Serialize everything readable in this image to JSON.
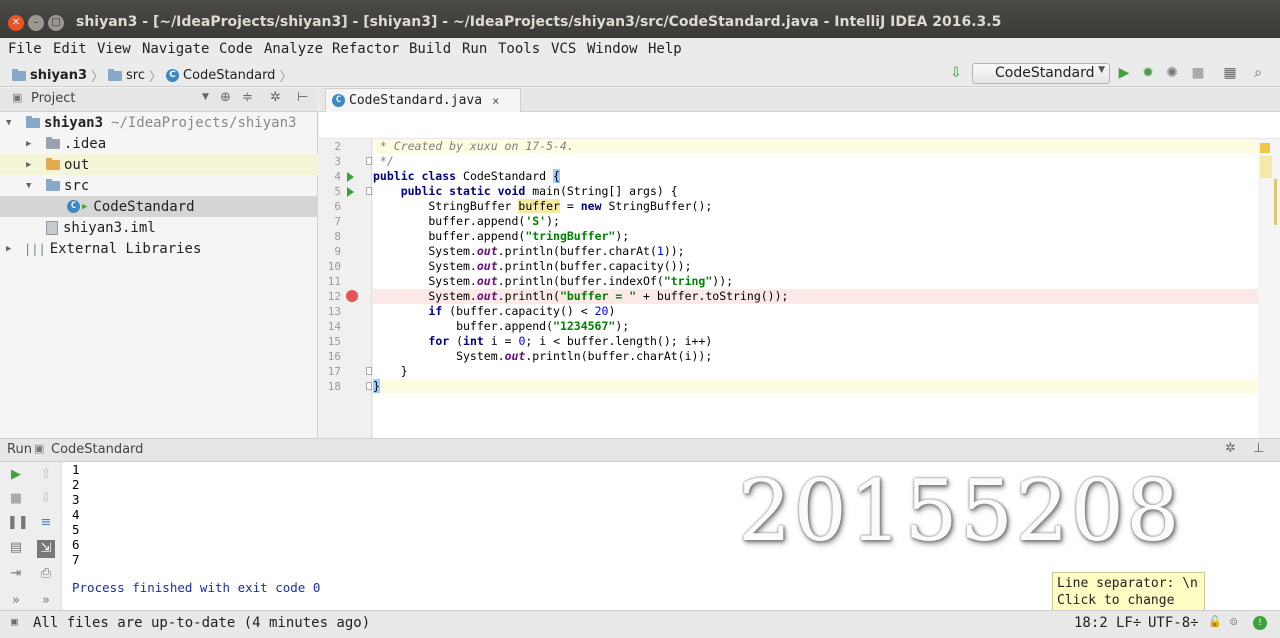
{
  "window": {
    "title": "shiyan3 - [~/IdeaProjects/shiyan3] - [shiyan3] - ~/IdeaProjects/shiyan3/src/CodeStandard.java - IntelliJ IDEA 2016.3.5"
  },
  "menu": [
    "File",
    "Edit",
    "View",
    "Navigate",
    "Code",
    "Analyze",
    "Refactor",
    "Build",
    "Run",
    "Tools",
    "VCS",
    "Window",
    "Help"
  ],
  "breadcrumb": [
    "shiyan3",
    "src",
    "CodeStandard"
  ],
  "toolbar": {
    "run_config": "CodeStandard"
  },
  "project_panel": {
    "title": "Project",
    "tree": [
      {
        "label": "shiyan3",
        "path": "~/IdeaProjects/shiyan3"
      },
      {
        "label": ".idea"
      },
      {
        "label": "out"
      },
      {
        "label": "src"
      },
      {
        "label": "CodeStandard"
      },
      {
        "label": "shiyan3.iml"
      },
      {
        "label": "External Libraries"
      }
    ]
  },
  "editor": {
    "tab": "CodeStandard.java",
    "line_numbers": [
      "2",
      "3",
      "4",
      "5",
      "6",
      "7",
      "8",
      "9",
      "10",
      "11",
      "12",
      "13",
      "14",
      "15",
      "16",
      "17",
      "18"
    ]
  },
  "run_panel": {
    "label": "Run",
    "config": "CodeStandard",
    "output": [
      "1",
      "2",
      "3",
      "4",
      "5",
      "6",
      "7"
    ],
    "process": "Process finished with exit code 0",
    "watermark": "20155208"
  },
  "tooltip": {
    "line1": "Line separator: \\n",
    "line2": "Click to change"
  },
  "status": {
    "message": "All files are up-to-date (4 minutes ago)",
    "position": "18:2",
    "line_sep": "LF÷",
    "encoding": "UTF-8÷"
  }
}
